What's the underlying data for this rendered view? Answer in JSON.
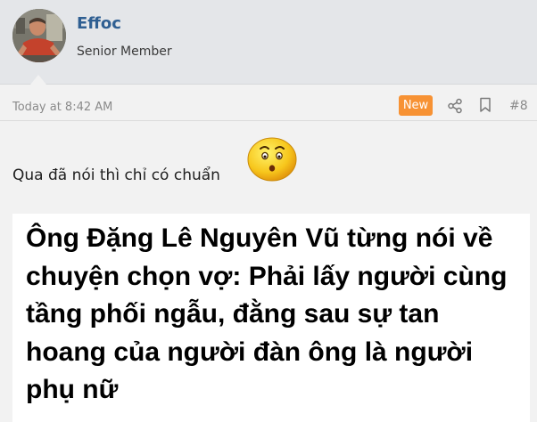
{
  "user": {
    "name": "Effoc",
    "title": "Senior Member"
  },
  "post": {
    "timestamp": "Today at 8:42 AM",
    "badge": "New",
    "number": "#8",
    "message": "Qua đã nói thì chỉ có chuẩn",
    "emoji": "worried-face-emoji",
    "image_text": "Ông Đặng Lê Nguyên Vũ từng nói về chuyện chọn vợ: Phải lấy người cùng tầng phối ngẫu, đằng sau sự tan hoang của người đàn ông là người phụ nữ"
  },
  "icons": {
    "share": "share-icon",
    "bookmark": "bookmark-icon"
  },
  "colors": {
    "username": "#2f5f92",
    "badge": "#f79234",
    "header_bg": "#e4e6e9",
    "post_bg": "#f2f2f2"
  }
}
